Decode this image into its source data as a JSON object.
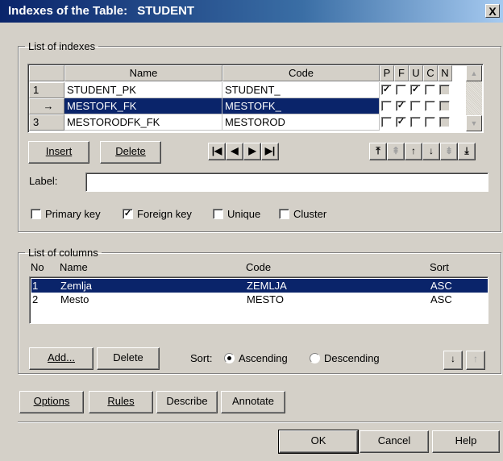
{
  "window": {
    "title_prefix": "Indexes of the Table:",
    "title_table": "STUDENT",
    "close": "X"
  },
  "indexes": {
    "legend": "List of indexes",
    "columns": {
      "name": "Name",
      "code": "Code",
      "p": "P",
      "f": "F",
      "u": "U",
      "c": "C",
      "n": "N"
    },
    "rows": [
      {
        "num": "1",
        "name": "STUDENT_PK",
        "code": "STUDENT_",
        "p": true,
        "f": false,
        "u": true,
        "c": false,
        "selected": false
      },
      {
        "num": "",
        "name": "MESTOFK_FK",
        "code": "MESTOFK_",
        "p": false,
        "f": true,
        "u": false,
        "c": false,
        "selected": true
      },
      {
        "num": "3",
        "name": "MESTORODFK_FK",
        "code": "MESTOROD",
        "p": false,
        "f": true,
        "u": false,
        "c": false,
        "selected": false
      }
    ],
    "insert_label": "Insert",
    "delete_label": "Delete",
    "label_caption": "Label:",
    "label_value": "",
    "primary_key": "Primary key",
    "foreign_key": "Foreign key",
    "unique": "Unique",
    "cluster": "Cluster",
    "checks": {
      "primary_key": false,
      "foreign_key": true,
      "unique": false,
      "cluster": false
    }
  },
  "icons": {
    "row_pointer": "→",
    "nav_first": "|◀",
    "nav_prev": "◀",
    "nav_next": "▶",
    "nav_last": "▶|",
    "move_top": "⤒",
    "move_up_page": "⇞",
    "move_up": "↑",
    "move_down": "↓",
    "move_down_page": "⇟",
    "move_bottom": "⤓",
    "scroll_up": "▲",
    "scroll_down": "▼",
    "check": "✓"
  },
  "columns": {
    "legend": "List of columns",
    "headers": {
      "no": "No",
      "name": "Name",
      "code": "Code",
      "sort": "Sort"
    },
    "rows": [
      {
        "no": "1",
        "name": "Zemlja",
        "code": "ZEMLJA",
        "sort": "ASC",
        "selected": true
      },
      {
        "no": "2",
        "name": "Mesto",
        "code": "MESTO",
        "sort": "ASC",
        "selected": false
      }
    ],
    "add_label": "Add...",
    "delete_label": "Delete",
    "sort_caption": "Sort:",
    "ascending": "Ascending",
    "descending": "Descending",
    "sort_value": "ascending"
  },
  "bottom": {
    "options": "Options",
    "rules": "Rules",
    "describe": "Describe",
    "annotate": "Annotate",
    "ok": "OK",
    "cancel": "Cancel",
    "help": "Help"
  },
  "colors": {
    "title_bar": "#0a246a",
    "selection": "#0a246a",
    "face": "#d4d0c8"
  }
}
